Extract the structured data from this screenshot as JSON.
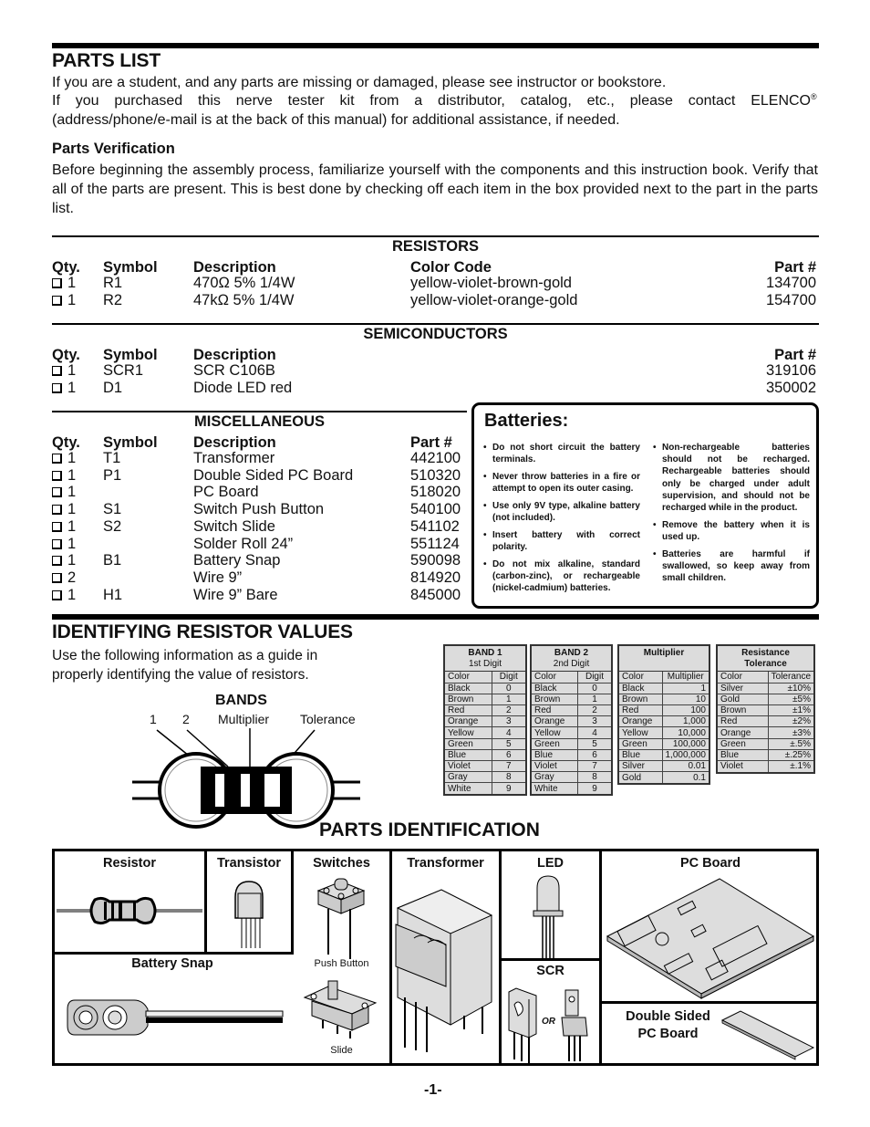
{
  "parts_list": {
    "title": "PARTS LIST",
    "intro_line1": "If you are a student, and any parts are missing or damaged, please see instructor or bookstore.",
    "intro_line2": "If you purchased this nerve tester kit from a distributor, catalog, etc., please contact ELENCO",
    "intro_registered": "®",
    "intro_line3": "(address/phone/e-mail is at the back of this manual) for additional assistance, if needed.",
    "verification_title": "Parts Verification",
    "verification_text": "Before beginning the assembly process, familiarize yourself with the components and this instruction book. Verify that all of the parts are present.  This is best done by checking off each item in the box provided next to the part in the parts list."
  },
  "resistors": {
    "title": "RESISTORS",
    "headers": {
      "qty": "Qty.",
      "symbol": "Symbol",
      "description": "Description",
      "color_code": "Color Code",
      "part": "Part #"
    },
    "rows": [
      {
        "qty": "1",
        "symbol": "R1",
        "description": "470Ω 5% 1/4W",
        "color_code": "yellow-violet-brown-gold",
        "part": "134700"
      },
      {
        "qty": "1",
        "symbol": "R2",
        "description": "47kΩ 5% 1/4W",
        "color_code": "yellow-violet-orange-gold",
        "part": "154700"
      }
    ]
  },
  "semiconductors": {
    "title": "SEMICONDUCTORS",
    "headers": {
      "qty": "Qty.",
      "symbol": "Symbol",
      "description": "Description",
      "part": "Part #"
    },
    "rows": [
      {
        "qty": "1",
        "symbol": "SCR1",
        "description": "SCR C106B",
        "part": "319106"
      },
      {
        "qty": "1",
        "symbol": "D1",
        "description": "Diode LED red",
        "part": "350002"
      }
    ]
  },
  "miscellaneous": {
    "title": "MISCELLANEOUS",
    "headers": {
      "qty": "Qty.",
      "symbol": "Symbol",
      "description": "Description",
      "part": "Part #"
    },
    "rows": [
      {
        "qty": "1",
        "symbol": "T1",
        "description": "Transformer",
        "part": "442100"
      },
      {
        "qty": "1",
        "symbol": "P1",
        "description": "Double Sided PC Board",
        "part": "510320"
      },
      {
        "qty": "1",
        "symbol": "",
        "description": "PC Board",
        "part": "518020"
      },
      {
        "qty": "1",
        "symbol": "S1",
        "description": "Switch Push Button",
        "part": "540100"
      },
      {
        "qty": "1",
        "symbol": "S2",
        "description": "Switch Slide",
        "part": "541102"
      },
      {
        "qty": "1",
        "symbol": "",
        "description": "Solder Roll 24”",
        "part": "551124"
      },
      {
        "qty": "1",
        "symbol": "B1",
        "description": "Battery Snap",
        "part": "590098"
      },
      {
        "qty": "2",
        "symbol": "",
        "description": "Wire 9”",
        "part": "814920"
      },
      {
        "qty": "1",
        "symbol": "H1",
        "description": "Wire 9” Bare",
        "part": "845000"
      }
    ]
  },
  "batteries": {
    "title": "Batteries:",
    "left": [
      "Do not short circuit the battery terminals.",
      "Never throw batteries in a fire or attempt to open its outer casing.",
      "Use only 9V type, alkaline battery (not included).",
      "Insert battery with correct polarity.",
      "Do not mix alkaline, standard (carbon-zinc), or rechargeable (nickel-cadmium) batteries."
    ],
    "right": [
      "Non-rechargeable batteries should not be recharged. Rechargeable batteries should only be charged under adult supervision, and should not be recharged while in the product.",
      "Remove the battery when it is used up.",
      "Batteries are harmful if swallowed, so keep away from small children."
    ]
  },
  "identifying": {
    "title": "IDENTIFYING RESISTOR VALUES",
    "text": "Use the following information as a guide in properly identifying the value of resistors.",
    "bands_title": "BANDS",
    "band_labels": [
      "1",
      "2",
      "Multiplier",
      "Tolerance"
    ],
    "tables": [
      {
        "title": "BAND 1",
        "subtitle": "1st Digit",
        "col1": "Color",
        "col2": "Digit",
        "rows": [
          [
            "Black",
            "0"
          ],
          [
            "Brown",
            "1"
          ],
          [
            "Red",
            "2"
          ],
          [
            "Orange",
            "3"
          ],
          [
            "Yellow",
            "4"
          ],
          [
            "Green",
            "5"
          ],
          [
            "Blue",
            "6"
          ],
          [
            "Violet",
            "7"
          ],
          [
            "Gray",
            "8"
          ],
          [
            "White",
            "9"
          ]
        ]
      },
      {
        "title": "BAND 2",
        "subtitle": "2nd Digit",
        "col1": "Color",
        "col2": "Digit",
        "rows": [
          [
            "Black",
            "0"
          ],
          [
            "Brown",
            "1"
          ],
          [
            "Red",
            "2"
          ],
          [
            "Orange",
            "3"
          ],
          [
            "Yellow",
            "4"
          ],
          [
            "Green",
            "5"
          ],
          [
            "Blue",
            "6"
          ],
          [
            "Violet",
            "7"
          ],
          [
            "Gray",
            "8"
          ],
          [
            "White",
            "9"
          ]
        ]
      },
      {
        "title": "Multiplier",
        "subtitle": "",
        "col1": "Color",
        "col2": "Multiplier",
        "rows": [
          [
            "Black",
            "1"
          ],
          [
            "Brown",
            "10"
          ],
          [
            "Red",
            "100"
          ],
          [
            "Orange",
            "1,000"
          ],
          [
            "Yellow",
            "10,000"
          ],
          [
            "Green",
            "100,000"
          ],
          [
            "Blue",
            "1,000,000"
          ],
          [
            "Silver",
            "0.01"
          ],
          [
            "Gold",
            "0.1"
          ]
        ]
      },
      {
        "title": "Resistance",
        "subtitle": "Tolerance",
        "col1": "Color",
        "col2": "Tolerance",
        "rows": [
          [
            "Silver",
            "±10%"
          ],
          [
            "Gold",
            "±5%"
          ],
          [
            "Brown",
            "±1%"
          ],
          [
            "Red",
            "±2%"
          ],
          [
            "Orange",
            "±3%"
          ],
          [
            "Green",
            "±.5%"
          ],
          [
            "Blue",
            "±.25%"
          ],
          [
            "Violet",
            "±.1%"
          ]
        ]
      }
    ]
  },
  "parts_identification": {
    "title": "PARTS IDENTIFICATION",
    "labels": {
      "resistor": "Resistor",
      "transistor": "Transistor",
      "switches": "Switches",
      "push_button": "Push Button",
      "slide": "Slide",
      "transformer": "Transformer",
      "led": "LED",
      "pc_board": "PC Board",
      "battery_snap": "Battery Snap",
      "scr": "SCR",
      "or": "OR",
      "double_sided_1": "Double Sided",
      "double_sided_2": "PC Board"
    }
  },
  "page_number": "-1-"
}
